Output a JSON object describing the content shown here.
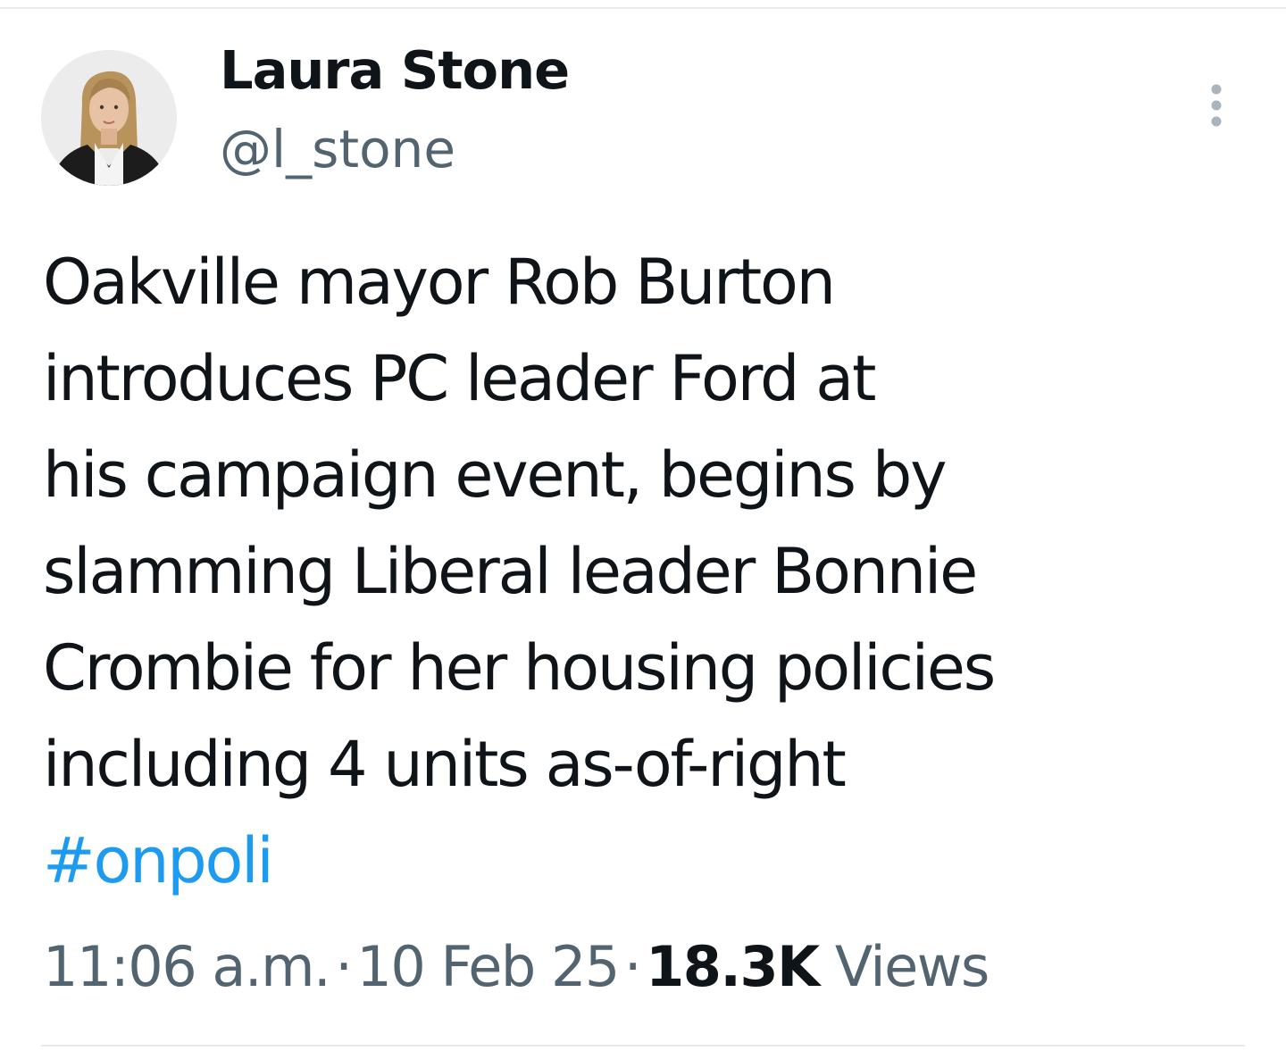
{
  "author": {
    "display_name": "Laura Stone",
    "handle": "@l_stone",
    "avatar_icon": "profile-photo"
  },
  "more_menu": {
    "icon": "more-vertical-icon"
  },
  "tweet": {
    "lines": [
      "Oakville mayor Rob Burton",
      "introduces PC leader Ford at",
      "his campaign event, begins by",
      "slamming Liberal leader Bonnie",
      "Crombie for her housing policies",
      "including 4 units as-of-right"
    ],
    "hashtag": "#onpoli"
  },
  "meta": {
    "time": "11:06 a.m.",
    "separator": "·",
    "date": "10 Feb 25",
    "views_count": "18.3K",
    "views_label": "Views"
  },
  "colors": {
    "text": "#0f1419",
    "secondary": "#536471",
    "link": "#1d9bf0",
    "divider": "#e7eaed"
  }
}
